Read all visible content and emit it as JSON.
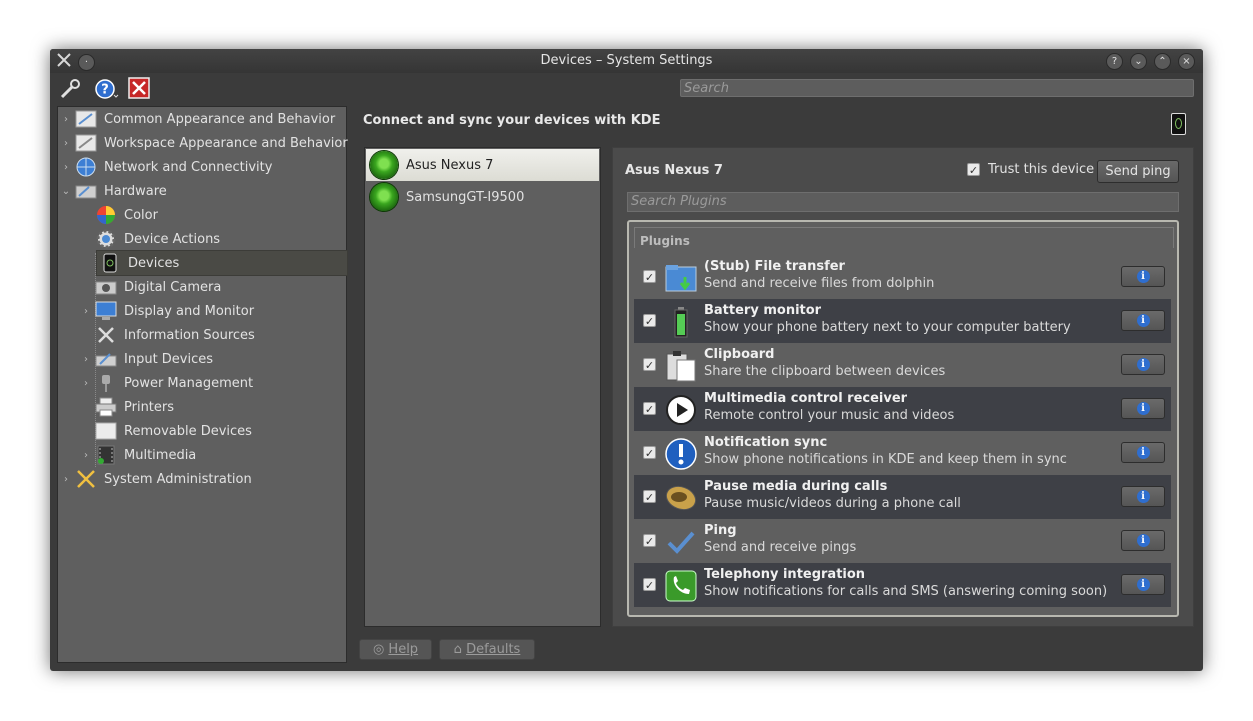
{
  "window": {
    "title": "Devices – System Settings"
  },
  "toolbar": {
    "search_placeholder": "Search"
  },
  "sidebar": {
    "items": [
      {
        "label": "Common Appearance and Behavior",
        "icon": "appearance-icon",
        "level": 0,
        "expandable": true
      },
      {
        "label": "Workspace Appearance and Behavior",
        "icon": "workspace-icon",
        "level": 0,
        "expandable": true
      },
      {
        "label": "Network and Connectivity",
        "icon": "network-globe-icon",
        "level": 0,
        "expandable": true
      },
      {
        "label": "Hardware",
        "icon": "hardware-icon",
        "level": 0,
        "expanded": true
      },
      {
        "label": "Color",
        "icon": "color-wheel-icon",
        "level": 1
      },
      {
        "label": "Device Actions",
        "icon": "device-actions-icon",
        "level": 1
      },
      {
        "label": "Devices",
        "icon": "phone-icon",
        "level": 1,
        "selected": true
      },
      {
        "label": "Digital Camera",
        "icon": "camera-icon",
        "level": 1
      },
      {
        "label": "Display and Monitor",
        "icon": "monitor-icon",
        "level": 1,
        "expandable": true
      },
      {
        "label": "Information Sources",
        "icon": "tools-icon",
        "level": 1
      },
      {
        "label": "Input Devices",
        "icon": "input-devices-icon",
        "level": 1,
        "expandable": true
      },
      {
        "label": "Power Management",
        "icon": "power-icon",
        "level": 1,
        "expandable": true
      },
      {
        "label": "Printers",
        "icon": "printer-icon",
        "level": 1
      },
      {
        "label": "Removable Devices",
        "icon": "removable-drive-icon",
        "level": 1
      },
      {
        "label": "Multimedia",
        "icon": "multimedia-icon",
        "level": 1,
        "expandable": true
      },
      {
        "label": "System Administration",
        "icon": "system-admin-icon",
        "level": 0,
        "expandable": true
      }
    ]
  },
  "main": {
    "heading": "Connect and sync your devices with KDE",
    "devices": [
      {
        "name": "Asus Nexus 7",
        "selected": true
      },
      {
        "name": "SamsungGT-I9500",
        "selected": false
      }
    ],
    "device_name": "Asus Nexus 7",
    "trust_label": "Trust this device",
    "trust_checked": true,
    "send_ping_label": "Send ping",
    "search_plugins_placeholder": "Search Plugins",
    "plugins_header": "Plugins",
    "plugins": [
      {
        "name": "(Stub) File transfer",
        "desc": "Send and receive files from dolphin",
        "icon": "folder-download-icon",
        "checked": true
      },
      {
        "name": "Battery monitor",
        "desc": "Show your phone battery next to your computer battery",
        "icon": "battery-icon",
        "checked": true
      },
      {
        "name": "Clipboard",
        "desc": "Share the clipboard between devices",
        "icon": "clipboard-icon",
        "checked": true
      },
      {
        "name": "Multimedia control receiver",
        "desc": "Remote control your music and videos",
        "icon": "play-icon",
        "checked": true
      },
      {
        "name": "Notification sync",
        "desc": "Show phone notifications in KDE and keep them in sync",
        "icon": "notification-icon",
        "checked": true
      },
      {
        "name": "Pause media during calls",
        "desc": "Pause music/videos during a phone call",
        "icon": "speaker-icon",
        "checked": true
      },
      {
        "name": "Ping",
        "desc": "Send and receive pings",
        "icon": "checkmark-icon",
        "checked": true
      },
      {
        "name": "Telephony integration",
        "desc": "Show notifications for calls and SMS (answering coming soon)",
        "icon": "telephone-icon",
        "checked": true
      }
    ],
    "help_label": "Help",
    "defaults_label": "Defaults"
  }
}
